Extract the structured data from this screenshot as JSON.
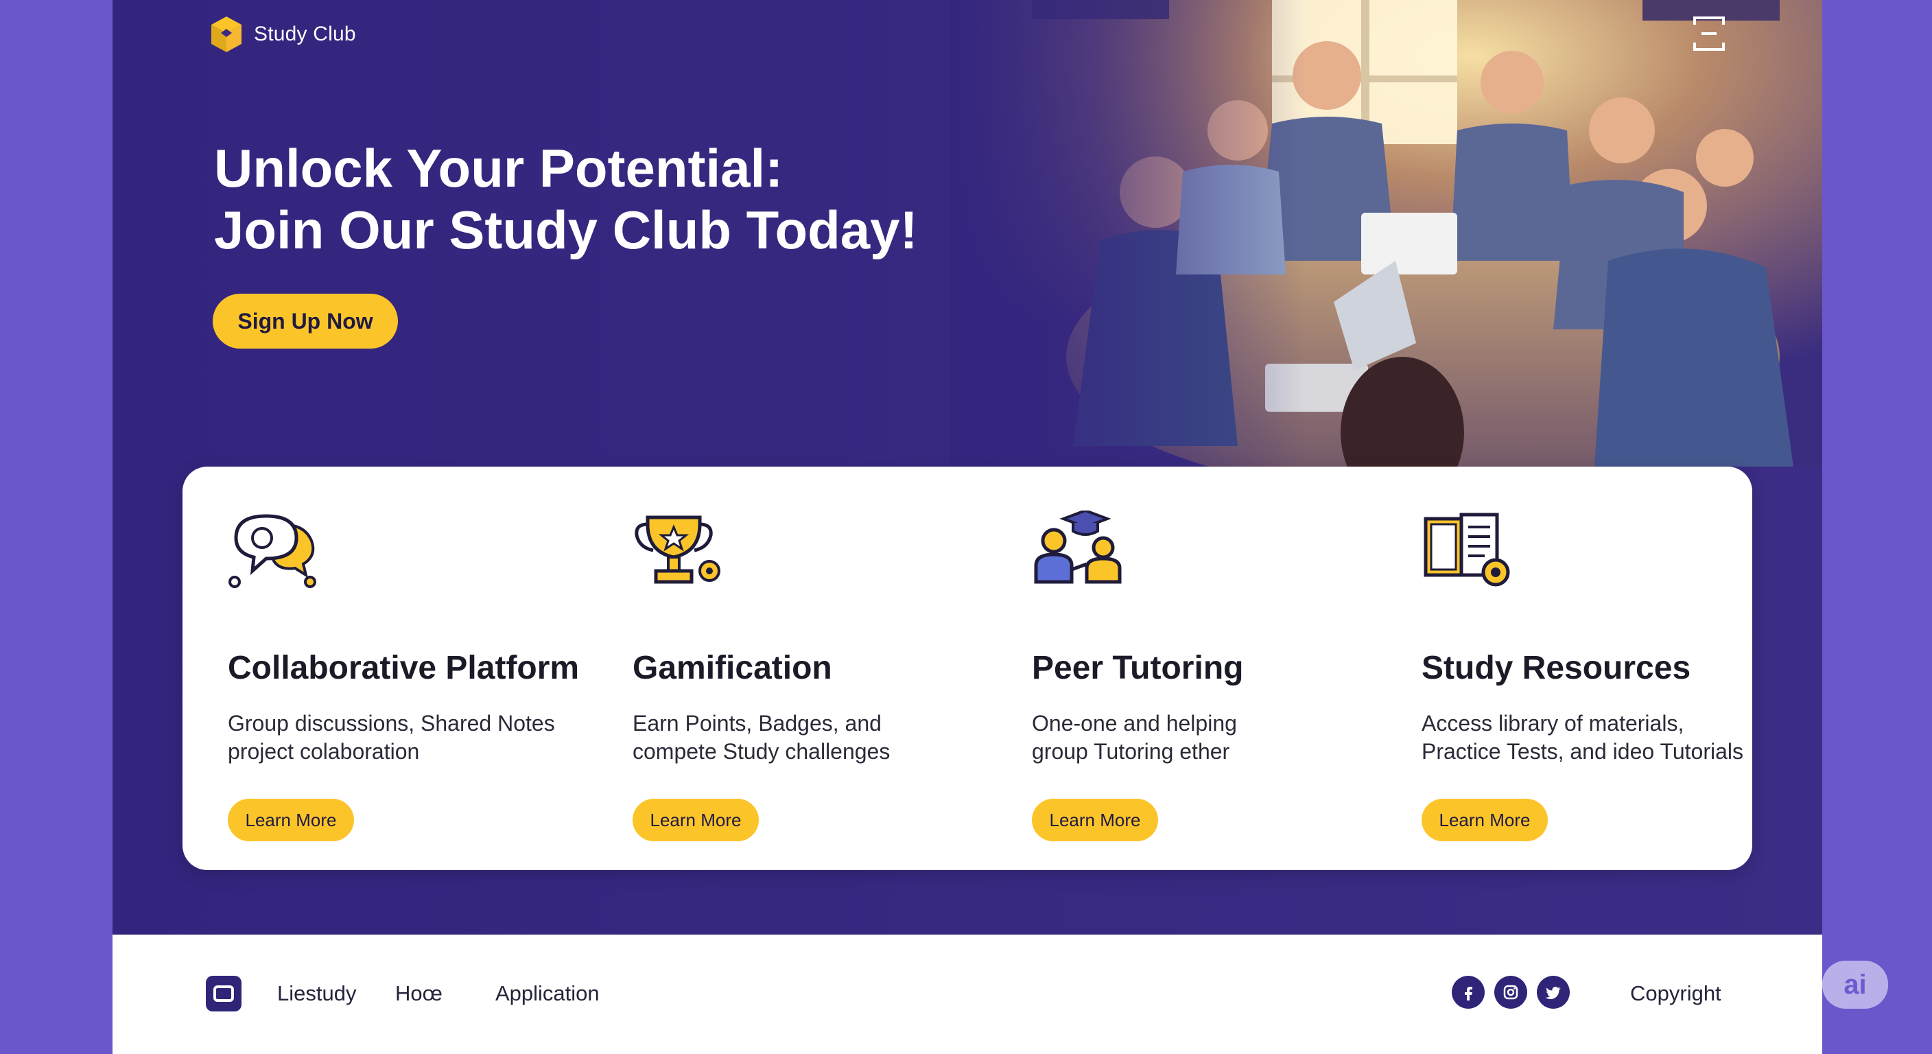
{
  "brand": {
    "name": "Study Club",
    "logo_icon": "cube-logo-icon"
  },
  "header": {
    "menu_icon": "menu-icon"
  },
  "hero": {
    "headline_line1": "Unlock Your Potential:",
    "headline_line2": "Join Our Study Club Today!",
    "cta_label": "Sign Up Now",
    "image": "students-studying-photo"
  },
  "features": [
    {
      "icon": "chat-bubbles-icon",
      "title": "Collaborative Platform",
      "desc_line1": "Group discussions, Shared Notes",
      "desc_line2": "project colaboration",
      "button": "Learn More"
    },
    {
      "icon": "trophy-icon",
      "title": "Gamification",
      "desc_line1": "Earn Points, Badges, and",
      "desc_line2": "compete Study challenges",
      "button": "Learn More"
    },
    {
      "icon": "graduation-people-icon",
      "title": "Peer Tutoring",
      "desc_line1": "One-one and helping",
      "desc_line2": "group Tutoring ether",
      "button": "Learn More"
    },
    {
      "icon": "book-library-icon",
      "title": "Study Resources",
      "desc_line1": "Access library of materials,",
      "desc_line2": "Practice Tests, and ideo Tutorials",
      "button": "Learn More"
    }
  ],
  "footer": {
    "links": [
      "Liestudy",
      "Hoœ",
      "Application"
    ],
    "social": [
      "facebook-icon",
      "instagram-icon",
      "twitter-icon"
    ],
    "copyright": "Copyright"
  },
  "badge": {
    "text": "ai"
  },
  "colors": {
    "accent": "#fbc52a",
    "primary": "#392a84",
    "side": "#6a57cc"
  }
}
